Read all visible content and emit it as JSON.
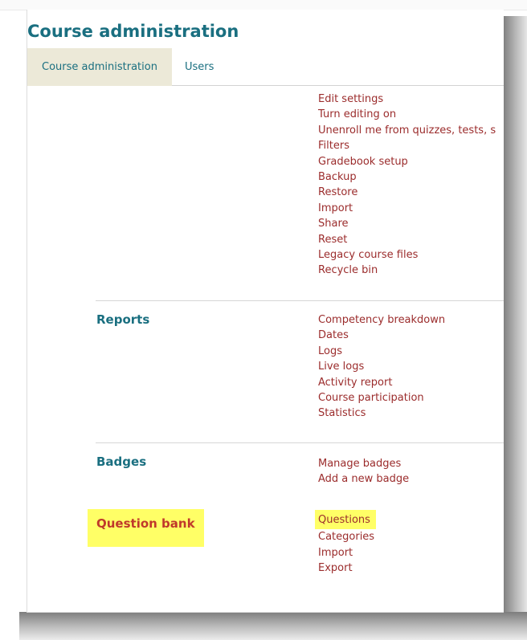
{
  "page": {
    "heading": "Course administration"
  },
  "tabs": [
    {
      "label": "Course administration",
      "active": true
    },
    {
      "label": "Users",
      "active": false
    }
  ],
  "course": {
    "links": [
      "Edit settings",
      "Turn editing on",
      "Unenroll me from quizzes, tests, s",
      "Filters",
      "Gradebook setup",
      "Backup",
      "Restore",
      "Import",
      "Share",
      "Reset",
      "Legacy course files",
      "Recycle bin"
    ]
  },
  "reports": {
    "title": "Reports",
    "links": [
      "Competency breakdown",
      "Dates",
      "Logs",
      "Live logs",
      "Activity report",
      "Course participation",
      "Statistics"
    ]
  },
  "badges": {
    "title": "Badges",
    "links": [
      "Manage badges",
      "Add a new badge"
    ]
  },
  "question_bank": {
    "title": "Question bank",
    "links": [
      "Questions",
      "Categories",
      "Import",
      "Export"
    ]
  },
  "colors": {
    "heading": "#1a6f80",
    "link": "#9b2c2c",
    "highlight": "#ffff66",
    "tab_bg": "#ece9d8"
  }
}
